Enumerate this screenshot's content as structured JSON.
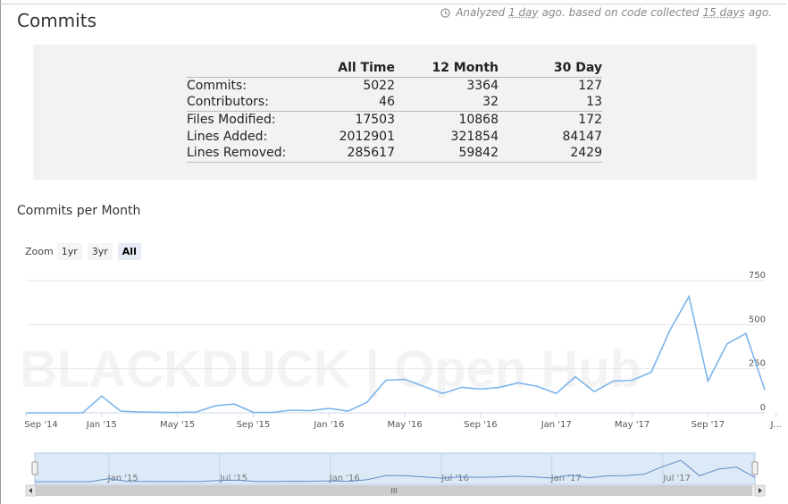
{
  "page_title": "Commits",
  "analyzed": {
    "prefix": "Analyzed",
    "age": "1 day",
    "middle": "ago. based on code collected",
    "collected": "15 days",
    "suffix": "ago."
  },
  "summary": {
    "columns": [
      "All Time",
      "12 Month",
      "30 Day"
    ],
    "rows": [
      {
        "label": "Commits:",
        "values": [
          "5022",
          "3364",
          "127"
        ]
      },
      {
        "label": "Contributors:",
        "values": [
          "46",
          "32",
          "13"
        ]
      },
      {
        "label": "Files Modified:",
        "values": [
          "17503",
          "10868",
          "172"
        ]
      },
      {
        "label": "Lines Added:",
        "values": [
          "2012901",
          "321854",
          "84147"
        ]
      },
      {
        "label": "Lines Removed:",
        "values": [
          "285617",
          "59842",
          "2429"
        ]
      }
    ]
  },
  "chart_section": {
    "title": "Commits per Month",
    "zoom_label": "Zoom",
    "zoom_buttons": [
      "1yr",
      "3yr",
      "All"
    ],
    "zoom_selected": "All",
    "watermark": "BLACKDUCK | Open Hub",
    "scrollbar_grip": "III"
  },
  "chart_data": {
    "type": "line",
    "title": "Commits per Month",
    "x": [
      "2014-09",
      "2014-10",
      "2014-11",
      "2014-12",
      "2015-01",
      "2015-02",
      "2015-03",
      "2015-04",
      "2015-05",
      "2015-06",
      "2015-07",
      "2015-08",
      "2015-09",
      "2015-10",
      "2015-11",
      "2015-12",
      "2016-01",
      "2016-02",
      "2016-03",
      "2016-04",
      "2016-05",
      "2016-06",
      "2016-07",
      "2016-08",
      "2016-09",
      "2016-10",
      "2016-11",
      "2016-12",
      "2017-01",
      "2017-02",
      "2017-03",
      "2017-04",
      "2017-05",
      "2017-06",
      "2017-07",
      "2017-08",
      "2017-09",
      "2017-10",
      "2017-11",
      "2017-12"
    ],
    "series": [
      {
        "values": [
          0,
          0,
          0,
          0,
          95,
          10,
          5,
          3,
          2,
          5,
          40,
          50,
          3,
          2,
          15,
          12,
          25,
          10,
          60,
          185,
          190,
          150,
          110,
          145,
          135,
          145,
          170,
          150,
          110,
          205,
          120,
          180,
          185,
          230,
          470,
          660,
          180,
          390,
          450,
          130
        ]
      }
    ],
    "ylim": [
      0,
      750
    ],
    "yticks": [
      0,
      250,
      500,
      750
    ],
    "xtick_labels": [
      "Sep '14",
      "Jan '15",
      "May '15",
      "Sep '15",
      "Jan '16",
      "May '16",
      "Sep '16",
      "Jan '17",
      "May '17",
      "Sep '17",
      "J..."
    ],
    "xtick_index": [
      0,
      4,
      8,
      12,
      16,
      20,
      24,
      28,
      32,
      36,
      39.6
    ],
    "navigator_labels": [
      "Jan '15",
      "Jul '15",
      "Jan '16",
      "Jul '16",
      "Jan '17",
      "Jul '17"
    ],
    "navigator_index": [
      4,
      10,
      16,
      22,
      28,
      34
    ],
    "line_color": "#7cb5ec",
    "grid": true
  }
}
